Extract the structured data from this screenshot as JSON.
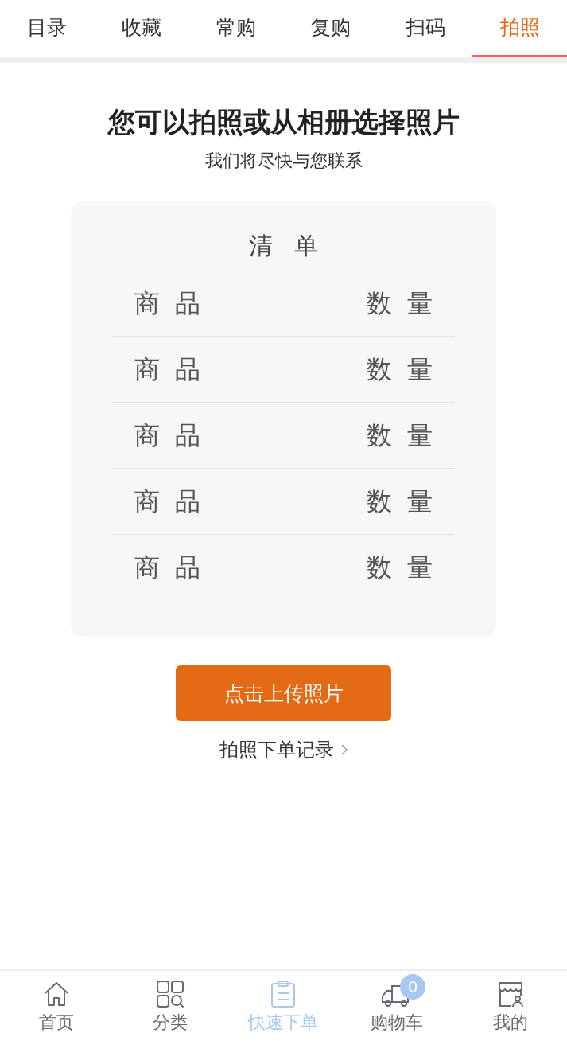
{
  "tabs": [
    {
      "label": "目录",
      "selected": false
    },
    {
      "label": "收藏",
      "selected": false
    },
    {
      "label": "常购",
      "selected": false
    },
    {
      "label": "复购",
      "selected": false
    },
    {
      "label": "扫码",
      "selected": false
    },
    {
      "label": "拍照",
      "selected": true
    }
  ],
  "heading": "您可以拍照或从相册选择照片",
  "subheading": "我们将尽快与您联系",
  "sample_list": {
    "title": "清单",
    "rows": [
      {
        "item": "商品",
        "quantity": "数量"
      },
      {
        "item": "商品",
        "quantity": "数量"
      },
      {
        "item": "商品",
        "quantity": "数量"
      },
      {
        "item": "商品",
        "quantity": "数量"
      },
      {
        "item": "商品",
        "quantity": "数量"
      }
    ]
  },
  "upload_button": "点击上传照片",
  "history_link": "拍照下单记录",
  "bottom_nav": [
    {
      "kind": "home",
      "label": "首页",
      "selected": false
    },
    {
      "kind": "category",
      "label": "分类",
      "selected": false
    },
    {
      "kind": "order",
      "label": "快速下单",
      "selected": true
    },
    {
      "kind": "cart",
      "label": "购物车",
      "selected": false,
      "badge": "0"
    },
    {
      "kind": "profile",
      "label": "我的",
      "selected": false
    }
  ]
}
